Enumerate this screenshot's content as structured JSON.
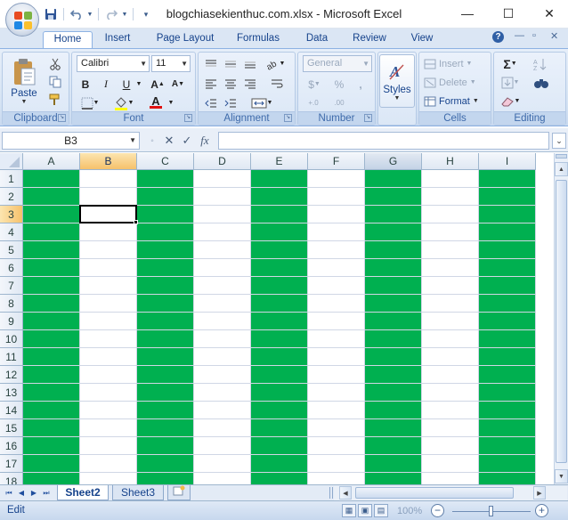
{
  "window": {
    "title": "blogchiasekienthuc.com.xlsx - Microsoft Excel",
    "minimize": "—",
    "maximize": "☐",
    "close": "✕"
  },
  "qat": {
    "save_icon": "save-icon",
    "undo_icon": "undo-icon",
    "redo_icon": "redo-icon",
    "customize_icon": "customize-icon"
  },
  "ribbon_tabs": [
    "Home",
    "Insert",
    "Page Layout",
    "Formulas",
    "Data",
    "Review",
    "View"
  ],
  "ribbon_controls": {
    "help": "?",
    "minimize": "—",
    "restore": "▫",
    "close": "✕"
  },
  "groups": {
    "clipboard": {
      "label": "Clipboard",
      "paste": "Paste"
    },
    "font": {
      "label": "Font",
      "font_name": "Calibri",
      "font_size": "11",
      "bold": "B",
      "italic": "I",
      "underline": "U",
      "grow": "A",
      "shrink": "A",
      "font_color": "A"
    },
    "alignment": {
      "label": "Alignment"
    },
    "number": {
      "label": "Number",
      "format": "General",
      "currency": "$",
      "percent": "%",
      "comma": ",",
      "inc_decimal": "+.0",
      "dec_decimal": ".00"
    },
    "styles": {
      "label": "Styles"
    },
    "cells": {
      "label": "Cells",
      "insert": "Insert",
      "delete": "Delete",
      "format": "Format"
    },
    "editing": {
      "label": "Editing",
      "sum": "Σ"
    }
  },
  "formula_bar": {
    "name_box": "B3",
    "cancel": "✕",
    "enter": "✓",
    "fx": "fx",
    "value": ""
  },
  "columns": [
    {
      "label": "A",
      "fill": "#00b050",
      "state": ""
    },
    {
      "label": "B",
      "fill": "",
      "state": "selected"
    },
    {
      "label": "C",
      "fill": "#00b050",
      "state": ""
    },
    {
      "label": "D",
      "fill": "",
      "state": ""
    },
    {
      "label": "E",
      "fill": "#00b050",
      "state": ""
    },
    {
      "label": "F",
      "fill": "",
      "state": ""
    },
    {
      "label": "G",
      "fill": "#00b050",
      "state": "hover"
    },
    {
      "label": "H",
      "fill": "",
      "state": ""
    },
    {
      "label": "I",
      "fill": "#00b050",
      "state": ""
    }
  ],
  "rows": [
    "1",
    "2",
    "3",
    "4",
    "5",
    "6",
    "7",
    "8",
    "9",
    "10",
    "11",
    "12",
    "13",
    "14",
    "15",
    "16",
    "17",
    "18"
  ],
  "selected_row": "3",
  "active_cell": "B3",
  "sheet_tabs": [
    {
      "label": "Sheet2",
      "active": true
    },
    {
      "label": "Sheet3",
      "active": false
    }
  ],
  "status": {
    "mode": "Edit",
    "zoom": "100%",
    "zoom_out": "−",
    "zoom_in": "+"
  },
  "colors": {
    "accent_green": "#00b050",
    "ribbon_blue": "#dbe6f4",
    "selection_orange": "#f6c16b"
  }
}
